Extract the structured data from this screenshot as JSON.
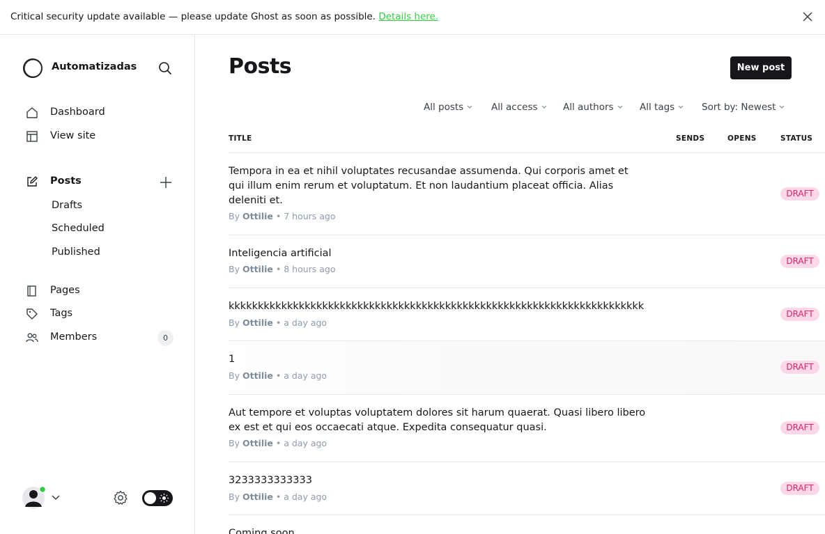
{
  "banner": {
    "message": "Critical security update available — please update Ghost as soon as possible.",
    "link_text": "Details here."
  },
  "sidebar": {
    "site_name": "Automatizadas",
    "nav": [
      {
        "label": "Dashboard",
        "icon": "home-icon"
      },
      {
        "label": "View site",
        "icon": "layout-icon"
      },
      {
        "label": "Posts",
        "icon": "edit-icon"
      },
      {
        "label": "Pages",
        "icon": "page-icon"
      },
      {
        "label": "Tags",
        "icon": "tag-icon"
      },
      {
        "label": "Members",
        "icon": "members-icon"
      }
    ],
    "post_subitems": [
      "Drafts",
      "Scheduled",
      "Published"
    ],
    "members_count": "0"
  },
  "main": {
    "title": "Posts",
    "new_post_label": "New post",
    "filters": [
      "All posts",
      "All access",
      "All authors",
      "All tags",
      "Sort by: Newest"
    ],
    "columns": {
      "title": "TITLE",
      "sends": "SENDS",
      "opens": "OPENS",
      "status": "STATUS"
    },
    "posts": [
      {
        "title": "Tempora in ea et nihil voluptates recusandae assumenda. Qui corporis amet et qui illum enim rerum et voluptatum. Et non laudantium placeat officia. Alias deleniti et.",
        "by": "By",
        "author": "Ottilie",
        "time": "• 7 hours ago",
        "status": "DRAFT"
      },
      {
        "title": "Inteligencia artificial",
        "by": "By",
        "author": "Ottilie",
        "time": "• 8 hours ago",
        "status": "DRAFT"
      },
      {
        "title": "kkkkkkkkkkkkkkkkkkkkkkkkkkkkkkkkkkkkkkkkkkkkkkkkkkkkkkkkkkkkkkkkkkkkkkk",
        "by": "By",
        "author": "Ottilie",
        "time": "• a day ago",
        "status": "DRAFT"
      },
      {
        "title": "1",
        "by": "By",
        "author": "Ottilie",
        "time": "• a day ago",
        "status": "DRAFT"
      },
      {
        "title": "Aut tempore et voluptas voluptatem dolores sit harum quaerat. Quasi libero libero ex est et qui eos occaecati atque. Expedita consequatur quasi.",
        "by": "By",
        "author": "Ottilie",
        "time": "• a day ago",
        "status": "DRAFT"
      },
      {
        "title": "3233333333333",
        "by": "By",
        "author": "Ottilie",
        "time": "• a day ago",
        "status": "DRAFT"
      },
      {
        "title": "Coming soon"
      }
    ]
  },
  "colors": {
    "accent_link": "#30cf43",
    "draft_bg": "#fbd7e8",
    "draft_text": "#e0246d",
    "online_dot": "#30cf43"
  }
}
